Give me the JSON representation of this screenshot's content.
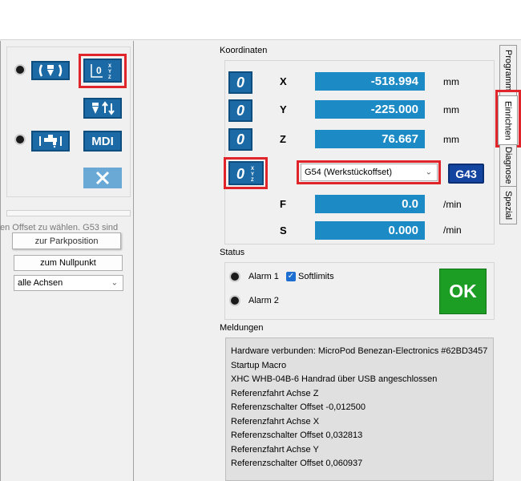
{
  "left_panel": {
    "overflow_text": "en Offset zu wählen. G53 sind",
    "park_button": "zur Parkposition",
    "zero_button": "zum Nullpunkt",
    "axes_select": "alle Achsen",
    "mdi_label": "MDI"
  },
  "koordinaten": {
    "title": "Koordinaten",
    "zero_glyph": "0",
    "axes": [
      {
        "label": "X",
        "value": "-518.994",
        "unit": "mm"
      },
      {
        "label": "Y",
        "value": "-225.000",
        "unit": "mm"
      },
      {
        "label": "Z",
        "value": "76.667",
        "unit": "mm"
      }
    ],
    "offset_select": "G54 (Werkstückoffset)",
    "g43_label": "G43",
    "feed": {
      "label": "F",
      "value": "0.0",
      "unit": "/min"
    },
    "spindle": {
      "label": "S",
      "value": "0.000",
      "unit": "/min"
    }
  },
  "status": {
    "title": "Status",
    "alarm1": "Alarm 1",
    "softlimits": "Softlimits",
    "alarm2": "Alarm 2",
    "ok_label": "OK"
  },
  "meldungen": {
    "title": "Meldungen",
    "lines": [
      "Hardware verbunden: MicroPod Benezan-Electronics #62BD3457",
      "Startup Macro",
      "XHC WHB-04B-6 Handrad über USB angeschlossen",
      "Referenzfahrt Achse Z",
      "Referenzschalter Offset -0,012500",
      "Referenzfahrt Achse X",
      "Referenzschalter Offset 0,032813",
      "Referenzfahrt Achse Y",
      "Referenzschalter Offset 0,060937"
    ]
  },
  "side_tabs": [
    "Programm",
    "Einrichten",
    "Diagnose",
    "Spezial"
  ],
  "colors": {
    "value_blue": "#1b8ac5",
    "button_blue": "#1b6aa5",
    "g43_blue": "#1345a0",
    "ok_green": "#1c9e24",
    "highlight_red": "#e0242a"
  }
}
